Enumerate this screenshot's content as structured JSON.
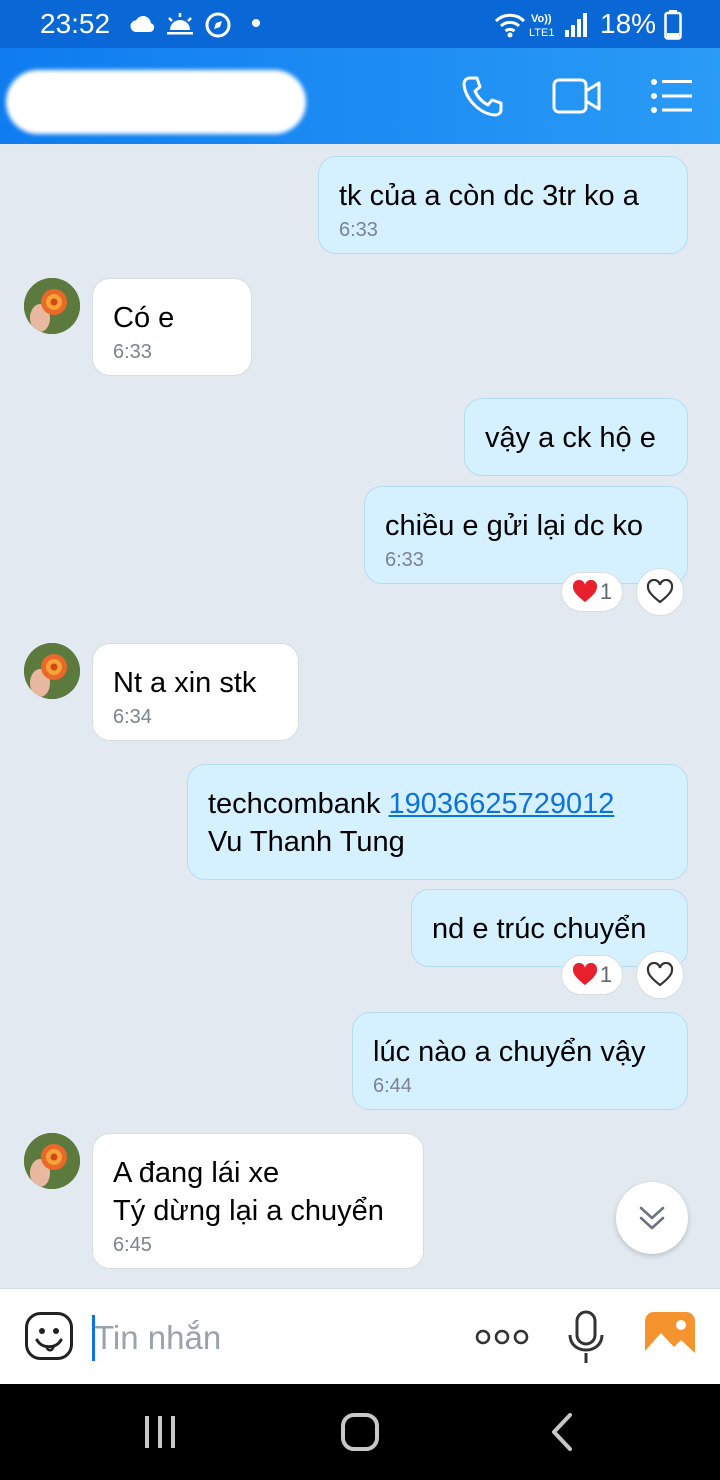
{
  "status_bar": {
    "time": "23:52",
    "battery": "18%",
    "icons": [
      "cloud-icon",
      "sunrise-icon",
      "compass-icon",
      "wifi-icon",
      "volte-icon",
      "signal-icon",
      "battery-icon"
    ]
  },
  "header": {
    "icons": [
      "phone-icon",
      "video-call-icon",
      "menu-list-icon"
    ]
  },
  "messages": [
    {
      "dir": "sent",
      "text": "tk của a còn dc 3tr ko a",
      "time": "6:33"
    },
    {
      "dir": "recv",
      "text": "Có e",
      "time": "6:33"
    },
    {
      "dir": "sent",
      "text": "vậy a ck hộ e",
      "time": ""
    },
    {
      "dir": "sent",
      "text": "chiều e gửi lại dc ko",
      "time": "6:33",
      "reaction_count": "1"
    },
    {
      "dir": "recv",
      "text": "Nt a xin stk",
      "time": "6:34"
    },
    {
      "dir": "sent",
      "text_prefix": "techcombank ",
      "link": "19036625729012",
      "text_suffix": "Vu Thanh Tung",
      "time": ""
    },
    {
      "dir": "sent",
      "text": "nd e trúc chuyển",
      "time": "",
      "reaction_count": "1"
    },
    {
      "dir": "sent",
      "text": "lúc nào a chuyển vậy",
      "time": "6:44"
    },
    {
      "dir": "recv",
      "text": "A đang lái xe\nTý dừng lại a chuyển",
      "time": "6:45"
    }
  ],
  "input": {
    "placeholder": "Tin nhắn",
    "icons": [
      "emoji-icon",
      "more-icon",
      "microphone-icon",
      "image-icon"
    ]
  },
  "colors": {
    "header": "#0f7cf0",
    "status_bar": "#0a68d6",
    "sent_bubble": "#d5f1ff",
    "recv_bubble": "#ffffff",
    "chat_bg": "#e2e9f1",
    "link": "#0a73e0",
    "heart": "#e8202e"
  }
}
